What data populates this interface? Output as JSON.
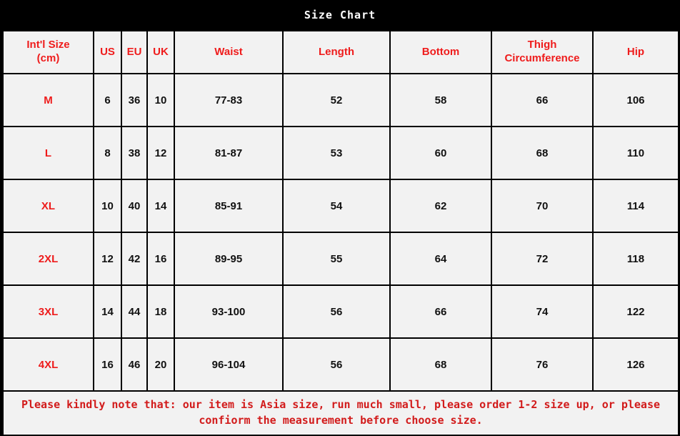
{
  "title": "Size Chart",
  "table": {
    "headers": [
      "Int'l Size\n(cm)",
      "US",
      "EU",
      "UK",
      "Waist",
      "Length",
      "Bottom",
      "Thigh\nCircumference",
      "Hip"
    ],
    "header_size_line1": "Int'l Size",
    "header_size_line2": "(cm)",
    "header_us": "US",
    "header_eu": "EU",
    "header_uk": "UK",
    "header_waist": "Waist",
    "header_length": "Length",
    "header_bottom": "Bottom",
    "header_thigh_line1": "Thigh",
    "header_thigh_line2": "Circumference",
    "header_hip": "Hip",
    "rows": [
      {
        "size": "M",
        "us": "6",
        "eu": "36",
        "uk": "10",
        "waist": "77-83",
        "length": "52",
        "bottom": "58",
        "thigh": "66",
        "hip": "106"
      },
      {
        "size": "L",
        "us": "8",
        "eu": "38",
        "uk": "12",
        "waist": "81-87",
        "length": "53",
        "bottom": "60",
        "thigh": "68",
        "hip": "110"
      },
      {
        "size": "XL",
        "us": "10",
        "eu": "40",
        "uk": "14",
        "waist": "85-91",
        "length": "54",
        "bottom": "62",
        "thigh": "70",
        "hip": "114"
      },
      {
        "size": "2XL",
        "us": "12",
        "eu": "42",
        "uk": "16",
        "waist": "89-95",
        "length": "55",
        "bottom": "64",
        "thigh": "72",
        "hip": "118"
      },
      {
        "size": "3XL",
        "us": "14",
        "eu": "44",
        "uk": "18",
        "waist": "93-100",
        "length": "56",
        "bottom": "66",
        "thigh": "74",
        "hip": "122"
      },
      {
        "size": "4XL",
        "us": "16",
        "eu": "46",
        "uk": "20",
        "waist": "96-104",
        "length": "56",
        "bottom": "68",
        "thigh": "76",
        "hip": "126"
      }
    ]
  },
  "note": {
    "line1": "Please  kindly note that: our item is Asia size, run much small, please order 1-2 size up,  or please",
    "line2": "confiorm the measurement before choose size."
  },
  "colors": {
    "background": "#000000",
    "title_text": "#ffffff",
    "cell_background": "#f2f2f2",
    "border": "#000000",
    "header_text": "#ef1c1c",
    "size_label_text": "#ee1b1b",
    "data_text": "#111111",
    "note_text": "#d21b1b"
  }
}
